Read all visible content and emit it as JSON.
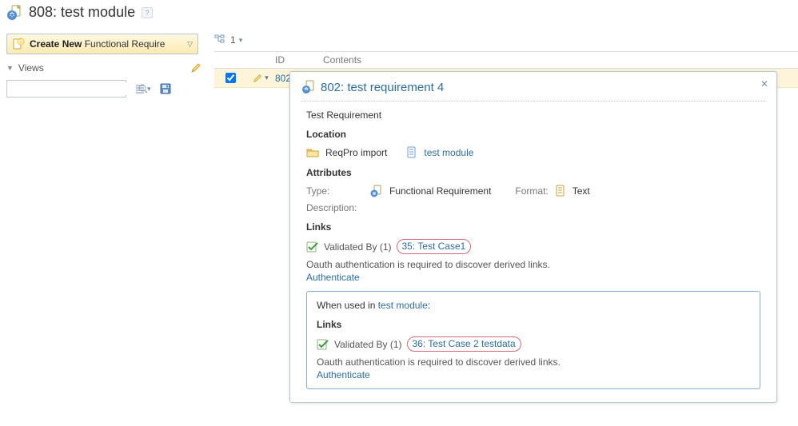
{
  "header": {
    "title": "808: test module"
  },
  "sidebar": {
    "createNew": {
      "bold": "Create New",
      "rest": " Functional Require"
    },
    "views_label": "Views"
  },
  "content": {
    "topbar_number": "1",
    "gridHeaders": {
      "id": "ID",
      "contents": "Contents"
    },
    "row": {
      "id": "802"
    }
  },
  "popover": {
    "title": "802: test requirement 4",
    "sub": "Test Requirement",
    "sections": {
      "location": {
        "label": "Location",
        "folder": "ReqPro import",
        "module": "test module"
      },
      "attributes": {
        "label": "Attributes",
        "type_label": "Type:",
        "type_value": "Functional Requirement",
        "format_label": "Format:",
        "format_value": "Text",
        "desc_label": "Description:"
      },
      "links": {
        "label": "Links",
        "validated_by": "Validated By (1)",
        "case1": "35: Test Case1",
        "oauth_note": "Oauth authentication is required to discover derived links.",
        "authenticate": "Authenticate"
      },
      "usedin": {
        "prefix": "When used in ",
        "module": "test module",
        "links_label": "Links",
        "validated_by": "Validated By (1)",
        "case2": "36: Test Case 2 testdata",
        "oauth_note": "Oauth authentication is required to discover derived links.",
        "authenticate": "Authenticate"
      }
    }
  }
}
